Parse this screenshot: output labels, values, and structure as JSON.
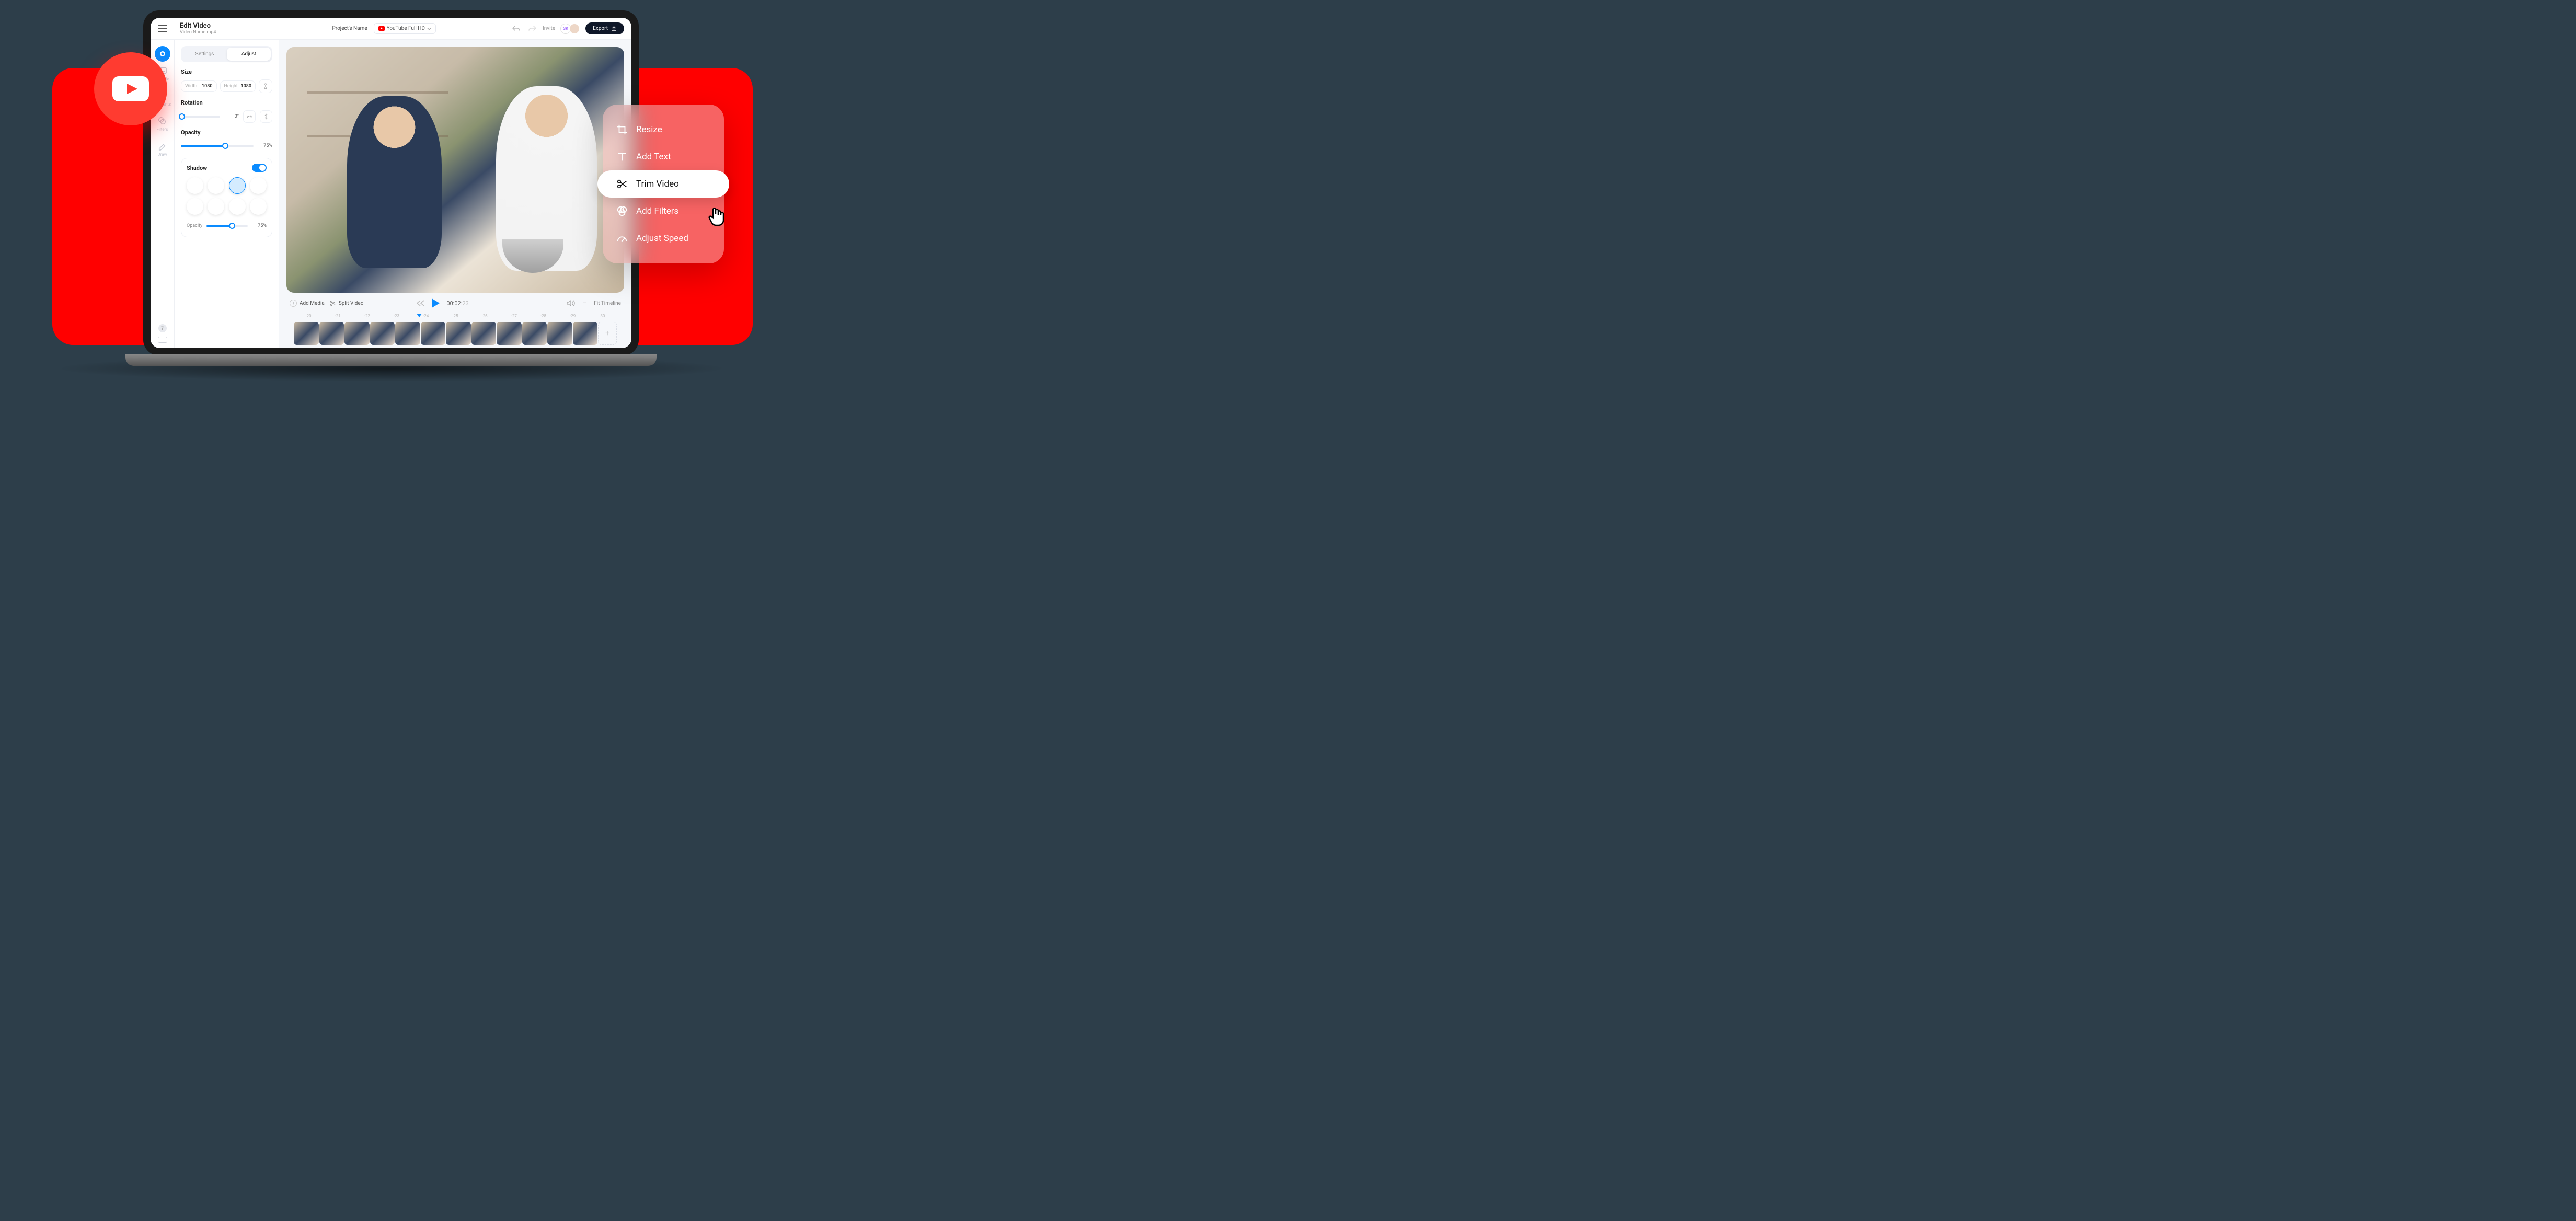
{
  "topbar": {
    "title": "Edit Video",
    "subtitle": "Video Name.mp4",
    "project_name": "Project's Name",
    "preset": "YouTube Full HD",
    "invite": "Invite",
    "avatar_initials": "SK",
    "export": "Export"
  },
  "rail": {
    "items": [
      {
        "label": "Subtitle"
      },
      {
        "label": "Elements"
      },
      {
        "label": "Filters"
      },
      {
        "label": "Draw"
      }
    ]
  },
  "panel": {
    "tabs": {
      "settings": "Settings",
      "adjust": "Adjust"
    },
    "size": {
      "label": "Size",
      "width_lbl": "Width",
      "width_val": "1080",
      "height_lbl": "Height",
      "height_val": "1080"
    },
    "rotation": {
      "label": "Rotation",
      "value": "0°"
    },
    "opacity": {
      "label": "Opacity",
      "value": "75%",
      "fill_pct": 61
    },
    "shadow": {
      "label": "Shadow",
      "on": true,
      "opacity_lbl": "Opacity",
      "opacity_val": "75%",
      "opacity_fill_pct": 62
    }
  },
  "playback": {
    "add_media": "Add Media",
    "split_video": "Split Video",
    "time_main": "00:02",
    "time_ms": ":23",
    "fit_timeline": "Fit Timeline"
  },
  "ruler": [
    ":20",
    ":21",
    ":22",
    ":23",
    ":24",
    ":25",
    ":26",
    ":27",
    ":28",
    ":29",
    ":30"
  ],
  "float_menu": {
    "items": [
      {
        "label": "Resize"
      },
      {
        "label": "Add Text"
      },
      {
        "label": "Trim Video",
        "active": true
      },
      {
        "label": "Add Filters"
      },
      {
        "label": "Adjust Speed"
      }
    ]
  }
}
